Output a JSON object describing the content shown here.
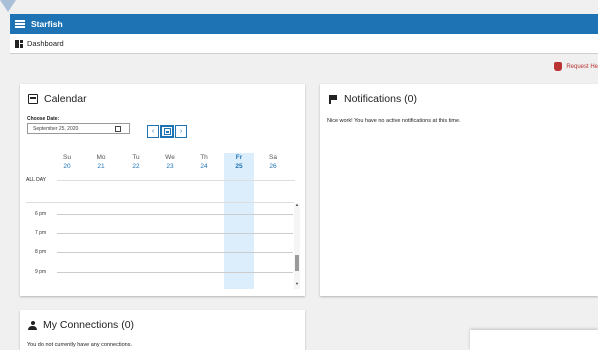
{
  "app": {
    "title": "Starfish"
  },
  "nav": {
    "breadcrumb": "Dashboard"
  },
  "actions": {
    "request_help": "Request He"
  },
  "calendar": {
    "title": "Calendar",
    "choose_label": "Choose Date:",
    "date_value": "September 25, 2020",
    "days": [
      {
        "name": "Su",
        "num": "20"
      },
      {
        "name": "Mo",
        "num": "21"
      },
      {
        "name": "Tu",
        "num": "22"
      },
      {
        "name": "We",
        "num": "23"
      },
      {
        "name": "Th",
        "num": "24"
      },
      {
        "name": "Fr",
        "num": "25"
      },
      {
        "name": "Sa",
        "num": "26"
      }
    ],
    "all_day": "ALL DAY",
    "hours": [
      "6 pm",
      "7 pm",
      "8 pm",
      "9 pm"
    ],
    "nav": {
      "prev": "‹",
      "next": "›"
    }
  },
  "notifications": {
    "title": "Notifications (0)",
    "message": "Nice work! You have no active notifications at this time."
  },
  "connections": {
    "title": "My Connections (0)",
    "message": "You do not currently have any connections."
  },
  "colors": {
    "topbar": "#1e73b4",
    "accent": "#1e73b4",
    "today_bg": "#dceefc",
    "request": "#b33333"
  }
}
